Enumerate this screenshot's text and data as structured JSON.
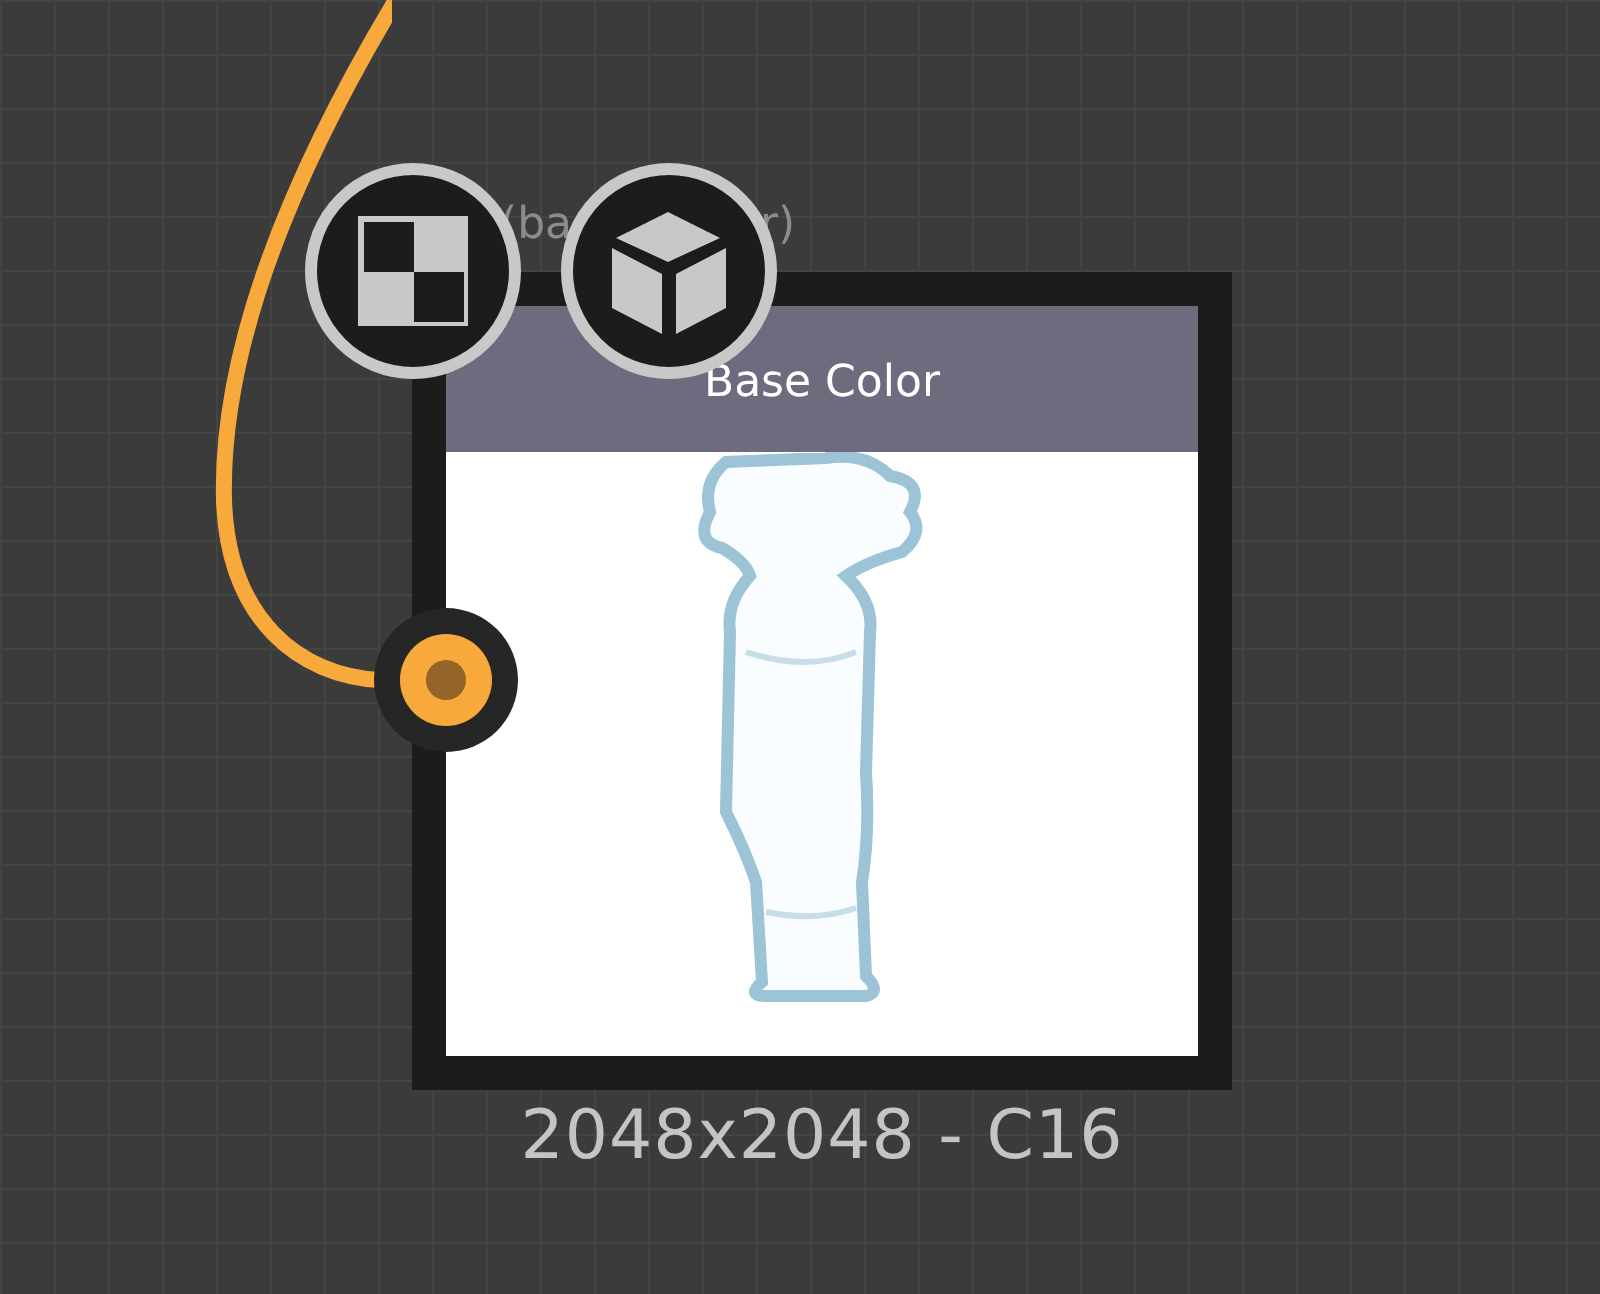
{
  "node": {
    "label_parts": [
      "(ba",
      "r)"
    ],
    "title": "Base Color",
    "footer": "2048x2048 - C16"
  }
}
